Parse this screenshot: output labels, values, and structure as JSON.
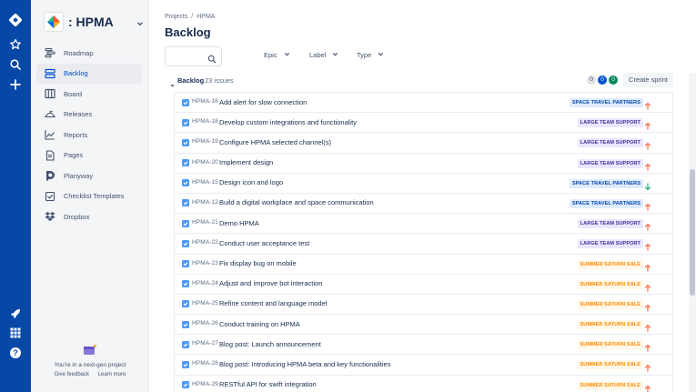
{
  "project": {
    "name": ": HPMA"
  },
  "global_nav": [
    "jira-logo-icon",
    "star-icon",
    "search-icon",
    "create-icon",
    "rocket-icon",
    "app-switcher-icon",
    "help-icon"
  ],
  "sidebar": {
    "items": [
      {
        "label": "Roadmap",
        "icon": "roadmap-icon",
        "active": false
      },
      {
        "label": "Backlog",
        "icon": "backlog-icon",
        "active": true
      },
      {
        "label": "Board",
        "icon": "board-icon",
        "active": false
      },
      {
        "label": "Releases",
        "icon": "releases-icon",
        "active": false
      },
      {
        "label": "Reports",
        "icon": "reports-icon",
        "active": false
      },
      {
        "label": "Pages",
        "icon": "pages-icon",
        "active": false
      },
      {
        "label": "Planyway",
        "icon": "planyway-icon",
        "active": false
      },
      {
        "label": "Checklist Templates",
        "icon": "checklist-icon",
        "active": false
      },
      {
        "label": "Dropbox",
        "icon": "dropbox-icon",
        "active": false
      }
    ],
    "footer": {
      "text": "You're in a next-gen project",
      "feedback": "Give feedback",
      "learn": "Learn more"
    }
  },
  "breadcrumb": {
    "projects": "Projects",
    "project": "HPMA"
  },
  "page_title": "Backlog",
  "filters": {
    "epic": "Epic",
    "label": "Label",
    "type": "Type"
  },
  "backlog": {
    "title": "Backlog",
    "count": "23 issues",
    "pills": [
      "0",
      "0",
      "0"
    ],
    "create_sprint": "Create sprint"
  },
  "colors": {
    "nav": "#0747a6",
    "accent": "#0052cc",
    "epic_space": {
      "bg": "#deebff",
      "fg": "#0747a6"
    },
    "epic_team": {
      "bg": "#eae6ff",
      "fg": "#403294"
    },
    "epic_saturn": {
      "bg": "#fff7e6",
      "fg": "#ff8b00"
    },
    "priority_up": "#ff7452",
    "priority_down": "#36b37e"
  },
  "issues": [
    {
      "key": "HPMA-16",
      "summary": "Add alert for slow connection",
      "epic": "SPACE TRAVEL PARTNERS",
      "epic_style": "space",
      "priority": "up"
    },
    {
      "key": "HPMA-18",
      "summary": "Develop custom integrations and functionality",
      "epic": "LARGE TEAM SUPPORT",
      "epic_style": "team",
      "priority": "up"
    },
    {
      "key": "HPMA-19",
      "summary": "Configure HPMA selected channel(s)",
      "epic": "LARGE TEAM SUPPORT",
      "epic_style": "team",
      "priority": "up"
    },
    {
      "key": "HPMA-20",
      "summary": "Implement design",
      "epic": "LARGE TEAM SUPPORT",
      "epic_style": "team",
      "priority": "up"
    },
    {
      "key": "HPMA-15",
      "summary": "Design icon and logo",
      "epic": "SPACE TRAVEL PARTNERS",
      "epic_style": "space",
      "priority": "down"
    },
    {
      "key": "HPMA-12",
      "summary": "Build a digital workplace and space communication",
      "epic": "SPACE TRAVEL PARTNERS",
      "epic_style": "space",
      "priority": "up"
    },
    {
      "key": "HPMA-21",
      "summary": "Demo HPMA",
      "epic": "LARGE TEAM SUPPORT",
      "epic_style": "team",
      "priority": "up"
    },
    {
      "key": "HPMA-22",
      "summary": "Conduct user acceptance test",
      "epic": "LARGE TEAM SUPPORT",
      "epic_style": "team",
      "priority": "up"
    },
    {
      "key": "HPMA-23",
      "summary": "Fix display bug on mobile",
      "epic": "SUMMER SATURN SALE",
      "epic_style": "saturn",
      "priority": "up"
    },
    {
      "key": "HPMA-24",
      "summary": "Adjust and improve bot interaction",
      "epic": "SUMMER SATURN SALE",
      "epic_style": "saturn",
      "priority": "up"
    },
    {
      "key": "HPMA-25",
      "summary": "Refine content and language model",
      "epic": "SUMMER SATURN SALE",
      "epic_style": "saturn",
      "priority": "up"
    },
    {
      "key": "HPMA-26",
      "summary": "Conduct training on HPMA",
      "epic": "SUMMER SATURN SALE",
      "epic_style": "saturn",
      "priority": "up"
    },
    {
      "key": "HPMA-27",
      "summary": "Blog post: Launch announcement",
      "epic": "SUMMER SATURN SALE",
      "epic_style": "saturn",
      "priority": "up"
    },
    {
      "key": "HPMA-28",
      "summary": "Blog post: Introducing HPMA beta and key functionalities",
      "epic": "SUMMER SATURN SALE",
      "epic_style": "saturn",
      "priority": "up"
    },
    {
      "key": "HPMA-29",
      "summary": "RESTful API for swift integration",
      "epic": "SUMMER SATURN SALE",
      "epic_style": "saturn",
      "priority": "up"
    }
  ]
}
